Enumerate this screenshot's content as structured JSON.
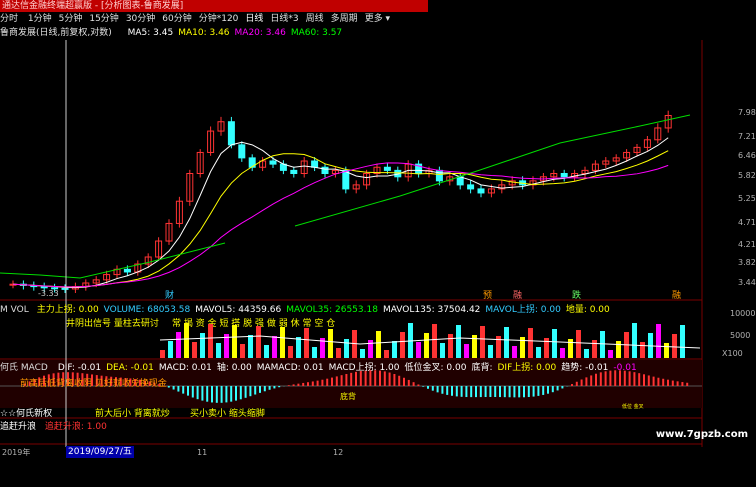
{
  "window": {
    "title": "通达信金融终端超赢版 - [分析图表-鲁商发展]"
  },
  "periods": [
    "1分钟",
    "5分钟",
    "15分钟",
    "30分钟",
    "60分钟",
    "分钟*120",
    "日线",
    "日线*3",
    "周线",
    "多周期",
    "更多 ▾"
  ],
  "periods_prefix": "分时",
  "price_panel": {
    "header": "鲁商发展(日线,前复权,对数)",
    "ma": [
      {
        "label": "MA5: 3.45",
        "color": "#ffffff"
      },
      {
        "label": "MA10: 3.46",
        "color": "#ffff00"
      },
      {
        "label": "MA20: 3.46",
        "color": "#ff00ff"
      },
      {
        "label": "MA60: 3.57",
        "color": "#00ff00"
      }
    ],
    "price_ticks": [
      "7.98",
      "7.21",
      "6.46",
      "5.82",
      "5.25",
      "4.71",
      "4.21",
      "3.82",
      "3.44"
    ],
    "low_label": "-3.33",
    "markers": [
      {
        "text": "财",
        "color": "#33ccff"
      },
      {
        "text": "预",
        "color": "#ff9900"
      },
      {
        "text": "融",
        "color": "#ff6666"
      },
      {
        "text": "跌",
        "color": "#66ff66"
      },
      {
        "text": "融",
        "color": "#ff9900"
      }
    ],
    "candles": [
      3.42,
      3.4,
      3.38,
      3.36,
      3.35,
      3.34,
      3.38,
      3.44,
      3.5,
      3.6,
      3.7,
      3.65,
      3.8,
      3.95,
      4.3,
      4.7,
      5.2,
      5.9,
      6.6,
      7.4,
      7.7,
      6.9,
      6.4,
      6.1,
      6.3,
      6.2,
      6.0,
      5.9,
      6.3,
      6.1,
      5.9,
      6.0,
      5.5,
      5.6,
      5.9,
      6.1,
      6.0,
      5.8,
      6.2,
      5.9,
      6.0,
      5.7,
      5.8,
      5.6,
      5.5,
      5.4,
      5.5,
      5.6,
      5.7,
      5.6,
      5.7,
      5.8,
      5.9,
      5.8,
      5.9,
      6.0,
      6.2,
      6.3,
      6.4,
      6.6,
      6.8,
      7.1,
      7.5,
      7.9
    ]
  },
  "vol_panel": {
    "header_prefix": "M VOL",
    "indicators": [
      {
        "label": "主力上拐: 0.00",
        "color": "#ffff00"
      },
      {
        "label": "VOLUME: 68053.58",
        "color": "#33ccff"
      },
      {
        "label": "MAVOL5: 44359.66",
        "color": "#ffffff"
      },
      {
        "label": "MAVOL35: 26553.18",
        "color": "#00ff00"
      },
      {
        "label": "MAVOL135: 37504.42",
        "color": "#ffffff"
      },
      {
        "label": "MAVOL上拐: 0.00",
        "color": "#33ccff"
      },
      {
        "label": "地量: 0.00",
        "color": "#ffff00"
      }
    ],
    "signal_text": "井阴出信号  量柱去研讨",
    "words_text": "常 揭 资 金 短 搭 脱 强 做 弱 休 常 空 仓",
    "ticks": [
      "10000",
      "5000"
    ],
    "unit": "X100"
  },
  "macd_panel": {
    "header_prefix": "何氏 MACD",
    "indicators": [
      {
        "label": "DIF: -0.01",
        "color": "#ffffff"
      },
      {
        "label": "DEA: -0.01",
        "color": "#ffff00"
      },
      {
        "label": "MACD: 0.01",
        "color": "#ffffff"
      },
      {
        "label": "轴: 0.00",
        "color": "#ffffff"
      },
      {
        "label": "MAMACD: 0.01",
        "color": "#ffffff"
      },
      {
        "label": "MACD上拐: 1.00",
        "color": "#ffffff"
      },
      {
        "label": "低位金叉: 0.00",
        "color": "#ffffff"
      },
      {
        "label": "底背:",
        "color": "#ffffff"
      },
      {
        "label": "DIF上拐: 0.00",
        "color": "#ffff00"
      },
      {
        "label": "趋势: -0.01",
        "color": "#ffffff"
      },
      {
        "label": "-0.01",
        "color": "#ff00ff"
      }
    ],
    "note1": "前高后低背离收阴  见好就收兑换现金",
    "tag_bottom": "底背",
    "tiny_label": "低位 金叉",
    "caption_title": "☆☆何氏新权",
    "captions": [
      "前大后小  背离就炒",
      "买小卖小  缩头缩脚"
    ]
  },
  "bottom_panel": {
    "header": "追赶升浪",
    "value": "追赶升浪: 1.00"
  },
  "date_axis": {
    "year": "2019年",
    "cursor_date": "2019/09/27/五",
    "ticks": [
      "11",
      "12"
    ]
  },
  "watermark": "www.7gpzb.com"
}
